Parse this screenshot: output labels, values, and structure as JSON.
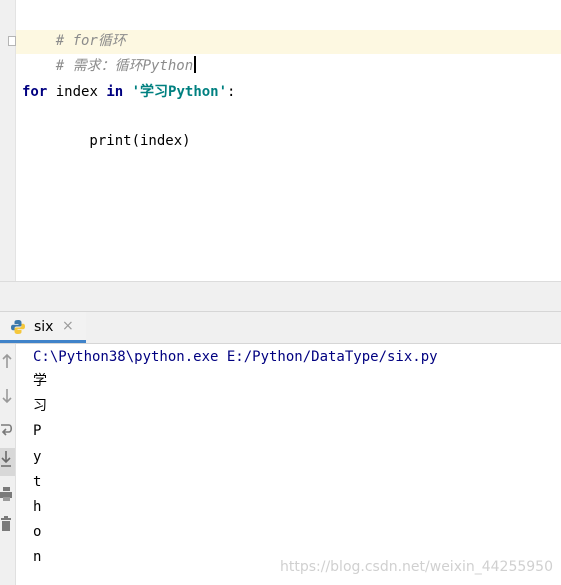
{
  "editor": {
    "line1_comment": "# for循环",
    "line2_comment": "# 需求：循环Python",
    "line4": {
      "kw_for": "for",
      "var": " index ",
      "kw_in": "in",
      "space": " ",
      "string": "'学习Python'",
      "colon": ":"
    },
    "line5": "    print(index)"
  },
  "run_tab": {
    "label": "six",
    "close": "×",
    "icon": "python-icon"
  },
  "toolbar_icons": [
    "arrow-up-icon",
    "arrow-down-icon",
    "soft-wrap-icon",
    "scroll-to-end-icon",
    "print-icon",
    "trash-icon"
  ],
  "console": {
    "command": "C:\\Python38\\python.exe E:/Python/DataType/six.py",
    "output": [
      "学",
      "习",
      "P",
      "y",
      "t",
      "h",
      "o",
      "n"
    ]
  },
  "watermark": "https://blog.csdn.net/weixin_44255950",
  "colors": {
    "keyword": "#000080",
    "string": "#008080",
    "comment": "#8c8c8c",
    "current_line": "#fdf8e1",
    "tab_underline": "#4083c9"
  }
}
